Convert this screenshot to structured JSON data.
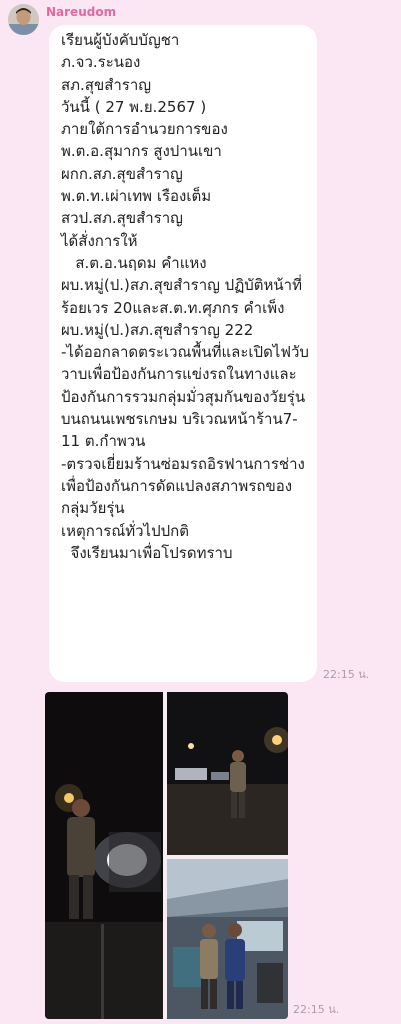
{
  "chat": {
    "sender_name": "Nareudom",
    "message_text": "เรียนผู้บังคับบัญชา\nภ.จว.ระนอง\nสภ.สุขสำราญ\nวันนี้ ( 27 พ.ย.2567 )\nภายใต้การอำนวยการของ\nพ.ต.อ.สุมากร สูงปานเขา\nผกก.สภ.สุขสำราญ\nพ.ต.ท.เผ่าเทพ เรืองเต็ม\nสวป.สภ.สุขสำราญ\nได้สั่งการให้\n   ส.ต.อ.นฤดม คำแหง\nผบ.หมู่(ป.)สภ.สุขสำราญ ปฏิบัติหน้าที่ร้อยเวร 20และส.ต.ท.ศุภกร คำเพ็ง ผบ.หมู่(ป.)สภ.สุขสำราญ 222\n-ได้ออกลาดตระเวณพื้นที่และเปิดไฟวับวาบเพื่อป้องกันการแข่งรถในทางและป้องกันการรวมกลุ่มมั่วสุมกันของวัยรุ่น บนถนนเพชรเกษม บริเวณหน้าร้าน7-11 ต.กำพวน\n-ตรวจเยี่ยมร้านซ่อมรถอิรฟานการช่าง เพื่อป้องกันการดัดแปลงสภาพรถของกลุ่มวัยรุ่น\nเหตุการณ์ทั่วไปปกติ\n  จึงเรียนมาเพื่อโปรดทราบ",
    "text_timestamp": "22:15 น.",
    "image_timestamp": "22:15 น."
  },
  "colors": {
    "background": "#fbe7f3",
    "sender_name": "#e4679f",
    "bubble": "#ffffff",
    "timestamp": "#b49aa8"
  },
  "icons": {
    "avatar": "user-photo-avatar"
  },
  "photos": [
    {
      "name": "night-checkpoint-officer"
    },
    {
      "name": "night-road-patrol"
    },
    {
      "name": "repair-shop-visit"
    }
  ]
}
